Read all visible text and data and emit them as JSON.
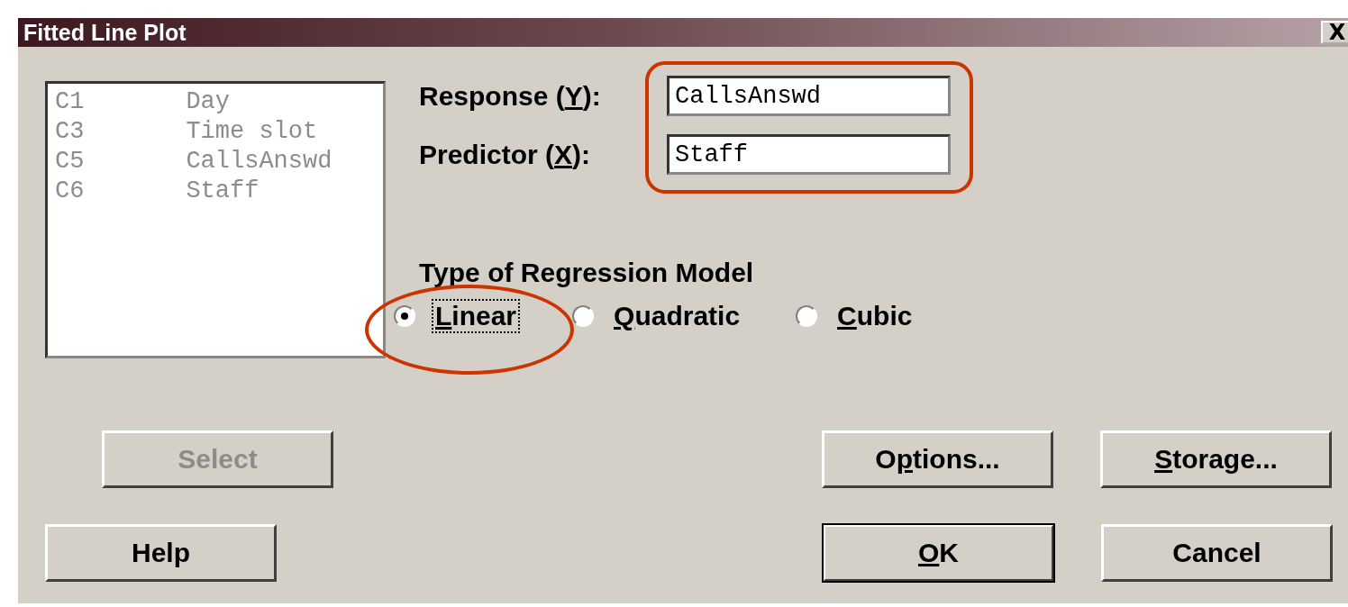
{
  "window": {
    "title": "Fitted Line Plot",
    "close": "X"
  },
  "column_list": {
    "disabled": true,
    "items": [
      {
        "id": "C1",
        "name": "Day"
      },
      {
        "id": "C3",
        "name": "Time slot"
      },
      {
        "id": "C5",
        "name": "CallsAnswd"
      },
      {
        "id": "C6",
        "name": "Staff"
      }
    ]
  },
  "fields_highlighted": true,
  "fields": [
    {
      "label": {
        "pre": "Response (",
        "key": "Y",
        "post": "):"
      },
      "value": "CallsAnswd"
    },
    {
      "label": {
        "pre": "Predictor (",
        "key": "X",
        "post": "):"
      },
      "value": "Staff"
    }
  ],
  "model": {
    "heading": "Type of Regression Model",
    "options": [
      {
        "label": {
          "key": "L",
          "post": "inear"
        },
        "selected": true,
        "focused": true,
        "highlighted": true
      },
      {
        "label": {
          "key": "Q",
          "post": "uadratic"
        },
        "selected": false,
        "focused": false,
        "highlighted": false
      },
      {
        "label": {
          "key": "C",
          "post": "ubic"
        },
        "selected": false,
        "focused": false,
        "highlighted": false
      }
    ]
  },
  "buttons": [
    {
      "label": {
        "pre": "Select"
      },
      "disabled": true,
      "default": false
    },
    {
      "label": {
        "pre": "O",
        "key": "p",
        "post": "tions..."
      },
      "disabled": false,
      "default": false
    },
    {
      "label": {
        "key": "S",
        "post": "torage..."
      },
      "disabled": false,
      "default": false
    },
    {
      "label": {
        "pre": "Help"
      },
      "disabled": false,
      "default": false
    },
    {
      "label": {
        "key": "O",
        "post": "K"
      },
      "disabled": false,
      "default": true
    },
    {
      "label": {
        "pre": "Cancel"
      },
      "disabled": false,
      "default": false
    }
  ]
}
